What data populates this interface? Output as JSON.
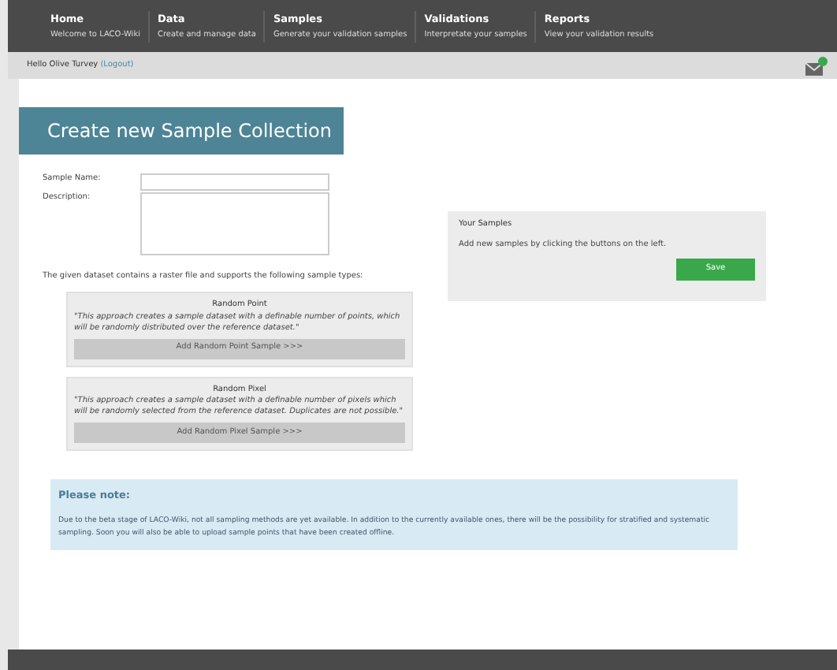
{
  "nav": [
    {
      "title": "Home",
      "subtitle": "Welcome to LACO-Wiki"
    },
    {
      "title": "Data",
      "subtitle": "Create and manage data"
    },
    {
      "title": "Samples",
      "subtitle": "Generate your validation samples"
    },
    {
      "title": "Validations",
      "subtitle": "Interpretate your samples"
    },
    {
      "title": "Reports",
      "subtitle": "View your validation results"
    }
  ],
  "greeting": {
    "text": "Hello Olive Turvey",
    "logout": "(Logout)"
  },
  "page_title": "Create new Sample Collection",
  "form": {
    "name_label": "Sample Name:",
    "description_label": "Description:"
  },
  "dataset_info": "The given dataset contains a raster file and supports the following sample types:",
  "sample_types": [
    {
      "title": "Random Point",
      "description": "\"This approach creates a sample dataset with a definable number of points, which will be randomly distributed over the reference dataset.\"",
      "button": "Add Random Point Sample >>>"
    },
    {
      "title": "Random Pixel",
      "description": "\"This approach creates a sample dataset with a definable number of pixels which will be randomly selected from the reference dataset. Duplicates are not possible.\"",
      "button": "Add Random Pixel Sample >>>"
    }
  ],
  "your_samples": {
    "title": "Your Samples",
    "text": "Add new samples by clicking the buttons on the left.",
    "button": "Save"
  },
  "note": {
    "title": "Please note:",
    "text": "Due to the beta stage of LACO-Wiki, not all sampling methods are yet available. In addition to the currently available ones, there will be the possibility for stratified and systematic sampling. Soon you will also be able to upload sample points that have been created offline."
  }
}
